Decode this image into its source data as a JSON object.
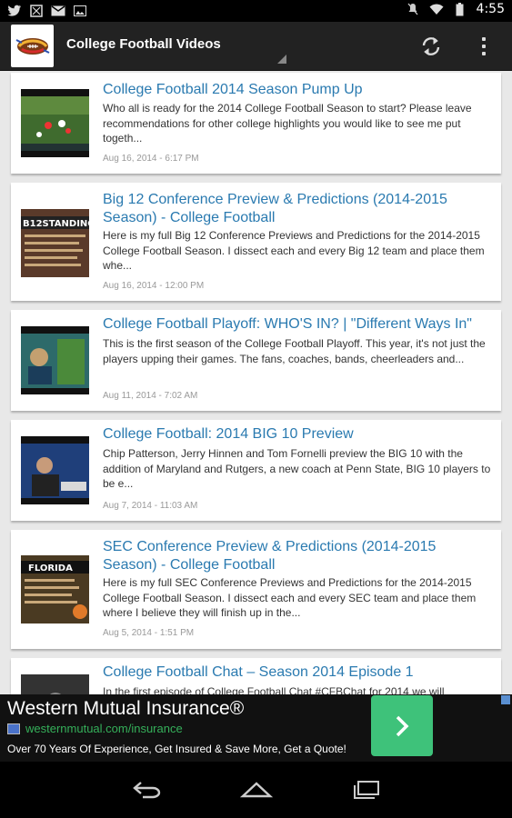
{
  "status_bar": {
    "time": "4:55",
    "left_icons": [
      "twitter-icon",
      "app-notification-icon",
      "gmail-icon",
      "image-icon"
    ],
    "right_icons": [
      "mute-icon",
      "wifi-icon",
      "battery-icon"
    ]
  },
  "action_bar": {
    "title": "College Football Videos"
  },
  "videos": [
    {
      "title": "College Football 2014 Season Pump Up",
      "description": "Who all is ready for the 2014 College Football Season to start? Please leave recommendations for other college highlights you would like to see me put togeth...",
      "date": "Aug 16, 2014 - 6:17 PM",
      "thumb_color": "#3f6b2e"
    },
    {
      "title": "Big 12 Conference Preview & Predictions (2014-2015 Season) - College Football",
      "description": "Here is my full Big 12 Conference Previews and Predictions for the 2014-2015 College Football Season. I dissect each and every Big 12 team and place them whe...",
      "date": "Aug 16, 2014 - 12:00 PM",
      "thumb_color": "#5a3a2a",
      "thumb_text": "B12STANDING"
    },
    {
      "title": "College Football Playoff: WHO'S IN? | \"Different Ways In\"",
      "description": "This is the first season of the College Football Playoff. This year, it's not just the players upping their games. The fans, coaches, bands, cheerleaders and...",
      "date": "Aug 11, 2014 - 7:02 AM",
      "thumb_color": "#2d6a6a"
    },
    {
      "title": "College Football: 2014 BIG 10 Preview",
      "description": "Chip Patterson, Jerry Hinnen and Tom Fornelli preview the BIG 10 with the addition of Maryland and Rutgers, a new coach at Penn State, BIG 10 players to be e...",
      "date": "Aug 7, 2014 - 11:03 AM",
      "thumb_color": "#1f3f7a"
    },
    {
      "title": "SEC Conference Preview & Predictions (2014-2015 Season) - College Football",
      "description": "Here is my full SEC Conference Previews and Predictions for the 2014-2015 College Football Season. I dissect each and every SEC team and place them where I believe they will finish up in the...",
      "date": "Aug 5, 2014 - 1:51 PM",
      "thumb_color": "#4a3a22",
      "thumb_text": "FLORIDA"
    },
    {
      "title": "College Football Chat – Season 2014 Episode 1",
      "description": "In the first episode of College Football Chat #CFBChat for 2014 we will",
      "date": "",
      "thumb_color": "#333333"
    }
  ],
  "ad": {
    "title": "Western Mutual Insurance®",
    "link": "westernmutual.com/insurance",
    "description": "Over 70 Years Of Experience, Get Insured & Save More, Get a Quote!",
    "cta_color": "#3ec27a"
  },
  "nav_bar": {
    "buttons": [
      "back-icon",
      "home-icon",
      "recent-apps-icon"
    ]
  }
}
